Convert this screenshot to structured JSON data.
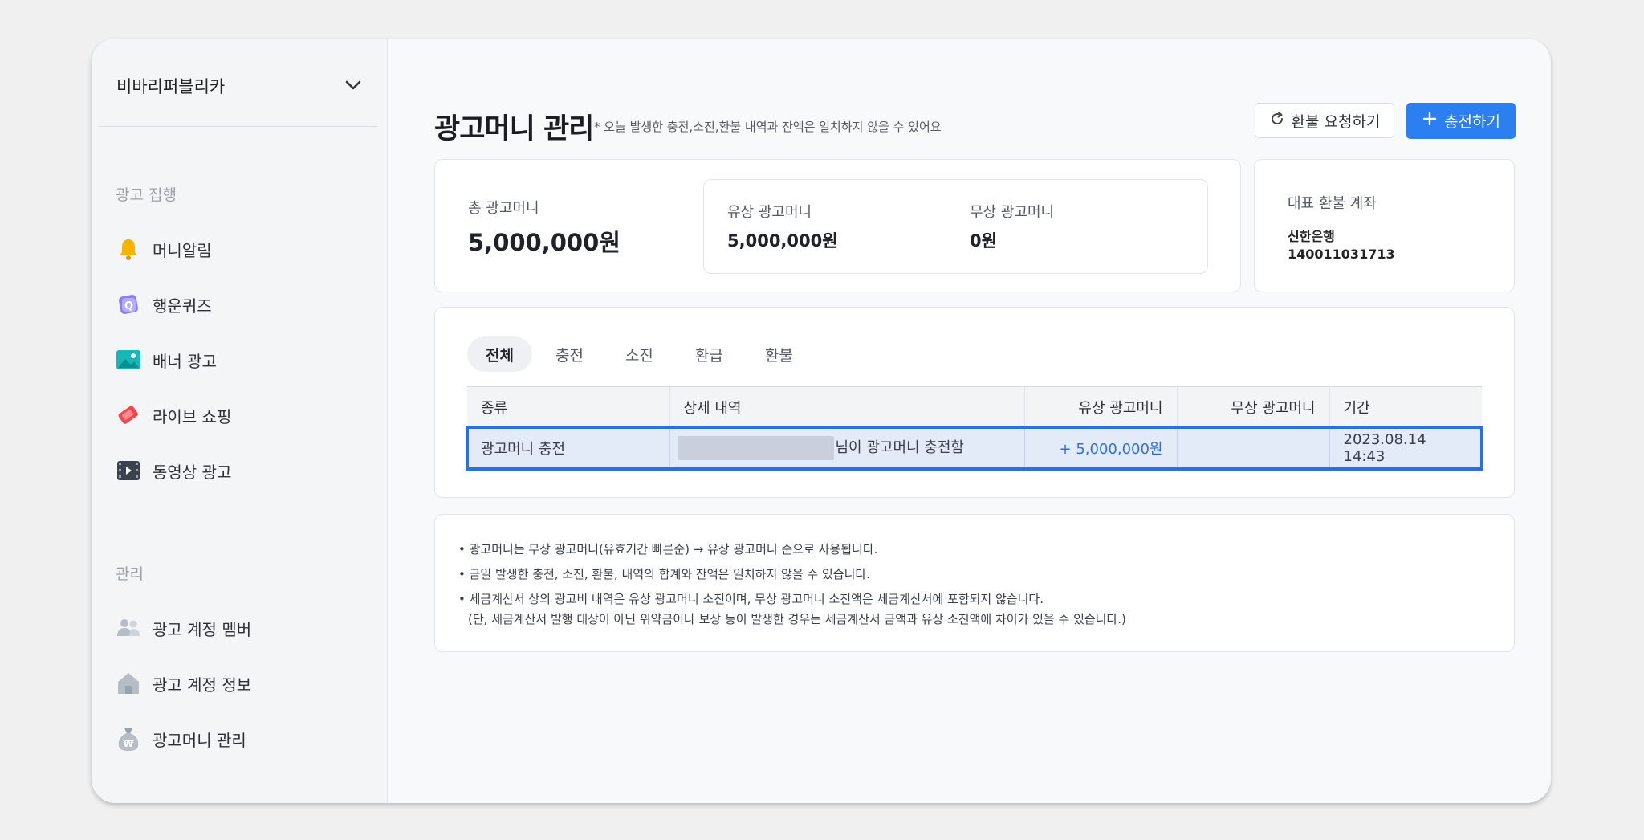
{
  "sidebar": {
    "account_name": "비바리퍼블리카",
    "section_ads": "광고 집행",
    "ad_items": [
      {
        "label": "머니알림",
        "icon": "bell-icon"
      },
      {
        "label": "행운퀴즈",
        "icon": "quiz-icon"
      },
      {
        "label": "배너 광고",
        "icon": "image-icon"
      },
      {
        "label": "라이브 쇼핑",
        "icon": "live-tag-icon"
      },
      {
        "label": "동영상 광고",
        "icon": "video-icon"
      }
    ],
    "section_manage": "관리",
    "manage_items": [
      {
        "label": "광고 계정 멤버",
        "icon": "people-icon"
      },
      {
        "label": "광고 계정 정보",
        "icon": "home-icon"
      },
      {
        "label": "광고머니 관리",
        "icon": "money-bag-icon"
      }
    ]
  },
  "header": {
    "title": "광고머니 관리",
    "note": "* 오늘 발생한 충전,소진,환불 내역과 잔액은 일치하지 않을 수 있어요",
    "refund_button": "환불 요청하기",
    "charge_button": "충전하기"
  },
  "summary": {
    "total_label": "총 광고머니",
    "total_value": "5,000,000원",
    "paid_label": "유상 광고머니",
    "paid_value": "5,000,000원",
    "free_label": "무상 광고머니",
    "free_value": "0원"
  },
  "refund_account": {
    "label": "대표 환불 계좌",
    "bank": "신한은행",
    "number": "140011031713"
  },
  "history": {
    "tabs": [
      "전체",
      "충전",
      "소진",
      "환급",
      "환불"
    ],
    "active_tab": "전체",
    "columns": [
      "종류",
      "상세 내역",
      "유상 광고머니",
      "무상 광고머니",
      "기간"
    ],
    "rows": [
      {
        "type": "광고머니 충전",
        "detail": "님이 광고머니 충전함",
        "paid": "+ 5,000,000원",
        "free": "",
        "date": "2023.08.14 14:43"
      }
    ]
  },
  "notes": [
    "• 광고머니는 무상 광고머니(유효기간 빠른순) → 유상 광고머니 순으로 사용됩니다.",
    "• 금일 발생한 충전, 소진, 환불, 내역의 합계와 잔액은 일치하지 않을 수 있습니다.",
    "• 세금계산서 상의 광고비 내역은 유상 광고머니 소진이며, 무상 광고머니 소진액은 세금계산서에 포함되지 않습니다.",
    "(단, 세금계산서 발행 대상이 아닌 위약금이나 보상 등이 발생한 경우는 세금계산서 금액과 유상 소진액에 차이가 있을 수 있습니다.)"
  ],
  "colors": {
    "accent": "#2b7ff0",
    "selection": "#2b6fe0"
  }
}
